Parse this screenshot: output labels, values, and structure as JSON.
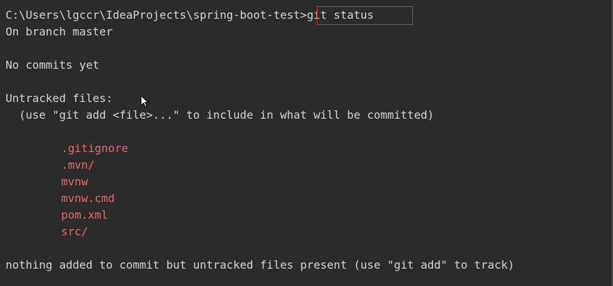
{
  "terminal": {
    "prompt": "C:\\Users\\lgccr\\IdeaProjects\\spring-boot-test>",
    "command": "git status",
    "branch_line": "On branch master",
    "commits_line": "No commits yet",
    "untracked_header": "Untracked files:",
    "untracked_hint": "  (use \"git add <file>...\" to include in what will be committed)",
    "untracked_files": [
      ".gitignore",
      ".mvn/",
      "mvnw",
      "mvnw.cmd",
      "pom.xml",
      "src/"
    ],
    "summary_line": "nothing added to commit but untracked files present (use \"git add\" to track)"
  },
  "colors": {
    "background": "#2b2b2b",
    "text": "#d4d4d4",
    "untracked": "#e06c6c",
    "highlight_border": "#d0342c"
  },
  "icons": {
    "cursor": "mouse-pointer-icon"
  }
}
